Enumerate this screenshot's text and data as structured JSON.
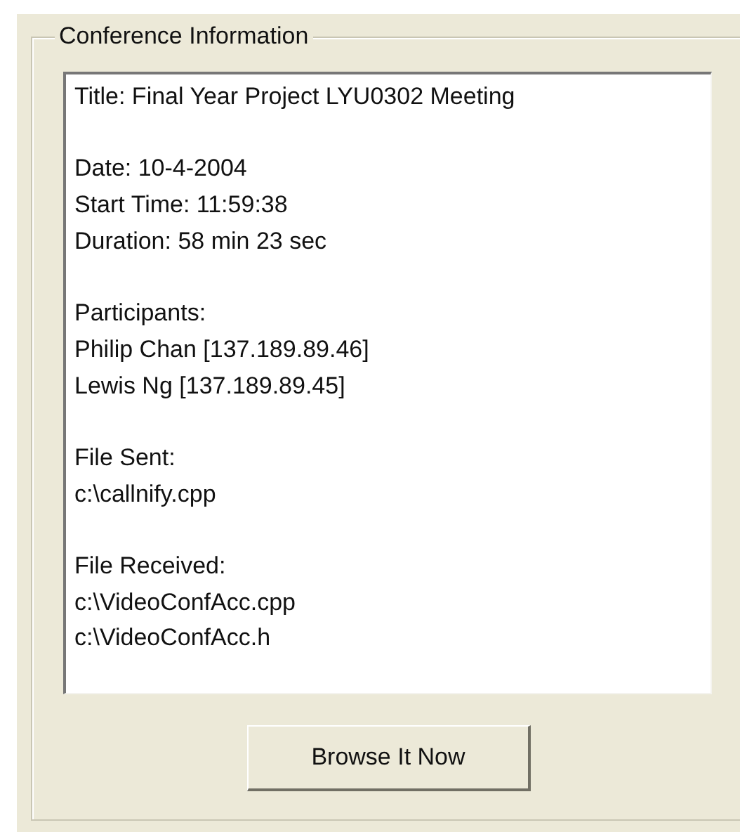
{
  "group_box": {
    "title": "Conference Information"
  },
  "info_sections": [
    [
      "Title: Final Year Project LYU0302 Meeting"
    ],
    [
      "Date: 10-4-2004",
      "Start Time: 11:59:38",
      "Duration: 58 min 23 sec"
    ],
    [
      "Participants:",
      "Philip Chan [137.189.89.46]",
      "Lewis Ng [137.189.89.45]"
    ],
    [
      "File Sent:",
      "c:\\callnify.cpp"
    ],
    [
      "File Received:",
      "c:\\VideoConfAcc.cpp",
      "c:\\VideoConfAcc.h"
    ]
  ],
  "buttons": [
    "Browse It Now"
  ]
}
